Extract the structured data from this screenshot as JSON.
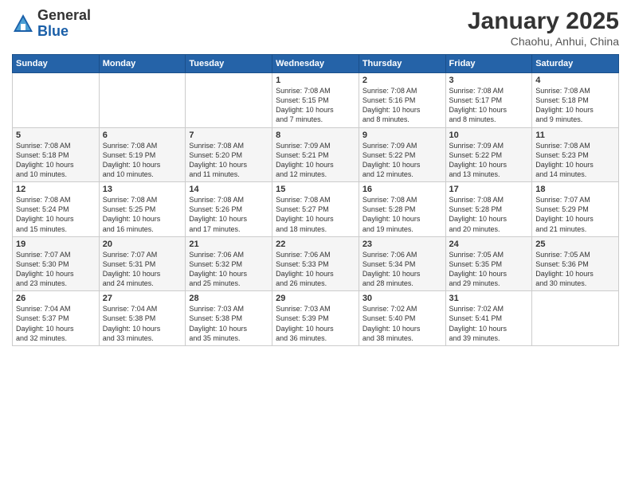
{
  "logo": {
    "general": "General",
    "blue": "Blue"
  },
  "title": "January 2025",
  "subtitle": "Chaohu, Anhui, China",
  "days_of_week": [
    "Sunday",
    "Monday",
    "Tuesday",
    "Wednesday",
    "Thursday",
    "Friday",
    "Saturday"
  ],
  "weeks": [
    [
      {
        "day": "",
        "info": ""
      },
      {
        "day": "",
        "info": ""
      },
      {
        "day": "",
        "info": ""
      },
      {
        "day": "1",
        "info": "Sunrise: 7:08 AM\nSunset: 5:15 PM\nDaylight: 10 hours\nand 7 minutes."
      },
      {
        "day": "2",
        "info": "Sunrise: 7:08 AM\nSunset: 5:16 PM\nDaylight: 10 hours\nand 8 minutes."
      },
      {
        "day": "3",
        "info": "Sunrise: 7:08 AM\nSunset: 5:17 PM\nDaylight: 10 hours\nand 8 minutes."
      },
      {
        "day": "4",
        "info": "Sunrise: 7:08 AM\nSunset: 5:18 PM\nDaylight: 10 hours\nand 9 minutes."
      }
    ],
    [
      {
        "day": "5",
        "info": "Sunrise: 7:08 AM\nSunset: 5:18 PM\nDaylight: 10 hours\nand 10 minutes."
      },
      {
        "day": "6",
        "info": "Sunrise: 7:08 AM\nSunset: 5:19 PM\nDaylight: 10 hours\nand 10 minutes."
      },
      {
        "day": "7",
        "info": "Sunrise: 7:08 AM\nSunset: 5:20 PM\nDaylight: 10 hours\nand 11 minutes."
      },
      {
        "day": "8",
        "info": "Sunrise: 7:09 AM\nSunset: 5:21 PM\nDaylight: 10 hours\nand 12 minutes."
      },
      {
        "day": "9",
        "info": "Sunrise: 7:09 AM\nSunset: 5:22 PM\nDaylight: 10 hours\nand 12 minutes."
      },
      {
        "day": "10",
        "info": "Sunrise: 7:09 AM\nSunset: 5:22 PM\nDaylight: 10 hours\nand 13 minutes."
      },
      {
        "day": "11",
        "info": "Sunrise: 7:08 AM\nSunset: 5:23 PM\nDaylight: 10 hours\nand 14 minutes."
      }
    ],
    [
      {
        "day": "12",
        "info": "Sunrise: 7:08 AM\nSunset: 5:24 PM\nDaylight: 10 hours\nand 15 minutes."
      },
      {
        "day": "13",
        "info": "Sunrise: 7:08 AM\nSunset: 5:25 PM\nDaylight: 10 hours\nand 16 minutes."
      },
      {
        "day": "14",
        "info": "Sunrise: 7:08 AM\nSunset: 5:26 PM\nDaylight: 10 hours\nand 17 minutes."
      },
      {
        "day": "15",
        "info": "Sunrise: 7:08 AM\nSunset: 5:27 PM\nDaylight: 10 hours\nand 18 minutes."
      },
      {
        "day": "16",
        "info": "Sunrise: 7:08 AM\nSunset: 5:28 PM\nDaylight: 10 hours\nand 19 minutes."
      },
      {
        "day": "17",
        "info": "Sunrise: 7:08 AM\nSunset: 5:28 PM\nDaylight: 10 hours\nand 20 minutes."
      },
      {
        "day": "18",
        "info": "Sunrise: 7:07 AM\nSunset: 5:29 PM\nDaylight: 10 hours\nand 21 minutes."
      }
    ],
    [
      {
        "day": "19",
        "info": "Sunrise: 7:07 AM\nSunset: 5:30 PM\nDaylight: 10 hours\nand 23 minutes."
      },
      {
        "day": "20",
        "info": "Sunrise: 7:07 AM\nSunset: 5:31 PM\nDaylight: 10 hours\nand 24 minutes."
      },
      {
        "day": "21",
        "info": "Sunrise: 7:06 AM\nSunset: 5:32 PM\nDaylight: 10 hours\nand 25 minutes."
      },
      {
        "day": "22",
        "info": "Sunrise: 7:06 AM\nSunset: 5:33 PM\nDaylight: 10 hours\nand 26 minutes."
      },
      {
        "day": "23",
        "info": "Sunrise: 7:06 AM\nSunset: 5:34 PM\nDaylight: 10 hours\nand 28 minutes."
      },
      {
        "day": "24",
        "info": "Sunrise: 7:05 AM\nSunset: 5:35 PM\nDaylight: 10 hours\nand 29 minutes."
      },
      {
        "day": "25",
        "info": "Sunrise: 7:05 AM\nSunset: 5:36 PM\nDaylight: 10 hours\nand 30 minutes."
      }
    ],
    [
      {
        "day": "26",
        "info": "Sunrise: 7:04 AM\nSunset: 5:37 PM\nDaylight: 10 hours\nand 32 minutes."
      },
      {
        "day": "27",
        "info": "Sunrise: 7:04 AM\nSunset: 5:38 PM\nDaylight: 10 hours\nand 33 minutes."
      },
      {
        "day": "28",
        "info": "Sunrise: 7:03 AM\nSunset: 5:38 PM\nDaylight: 10 hours\nand 35 minutes."
      },
      {
        "day": "29",
        "info": "Sunrise: 7:03 AM\nSunset: 5:39 PM\nDaylight: 10 hours\nand 36 minutes."
      },
      {
        "day": "30",
        "info": "Sunrise: 7:02 AM\nSunset: 5:40 PM\nDaylight: 10 hours\nand 38 minutes."
      },
      {
        "day": "31",
        "info": "Sunrise: 7:02 AM\nSunset: 5:41 PM\nDaylight: 10 hours\nand 39 minutes."
      },
      {
        "day": "",
        "info": ""
      }
    ]
  ]
}
